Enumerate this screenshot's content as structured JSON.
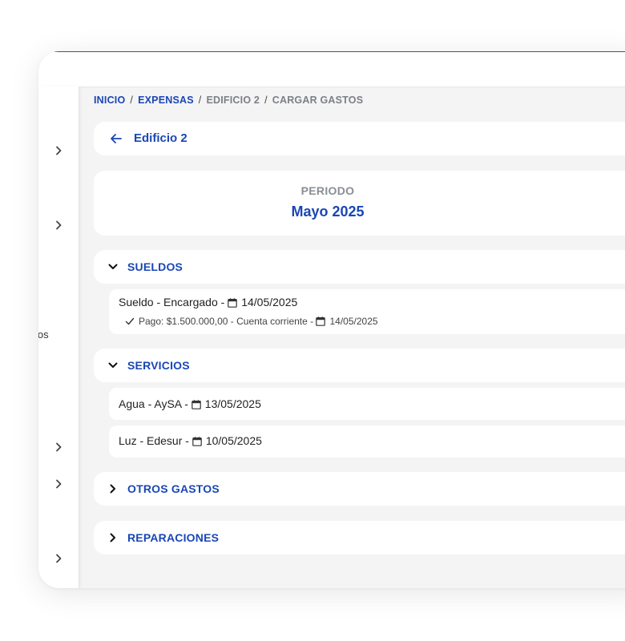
{
  "breadcrumb": {
    "items": [
      "INICIO",
      "EXPENSAS",
      "EDIFICIO 2",
      "CARGAR GASTOS"
    ],
    "separator": "/"
  },
  "header": {
    "back_title": "Edificio 2"
  },
  "period": {
    "label": "PERIODO",
    "value": "Mayo 2025"
  },
  "sidebar": {
    "partial_text": "ios"
  },
  "sections": {
    "sueldos": {
      "title": "SUELDOS",
      "items": [
        {
          "prefix": "Sueldo - Encargado - ",
          "date": "14/05/2025",
          "payment": {
            "prefix": "Pago: $1.500.000,00 - Cuenta corriente - ",
            "date": "14/05/2025"
          }
        }
      ]
    },
    "servicios": {
      "title": "SERVICIOS",
      "items": [
        {
          "prefix": "Agua - AySA - ",
          "date": "13/05/2025"
        },
        {
          "prefix": "Luz - Edesur - ",
          "date": "10/05/2025"
        }
      ]
    },
    "otros": {
      "title": "OTROS GASTOS"
    },
    "reparaciones": {
      "title": "REPARACIONES"
    }
  },
  "colors": {
    "accent": "#1a46b5",
    "muted": "#8a8d93",
    "background": "#f4f4f5"
  }
}
